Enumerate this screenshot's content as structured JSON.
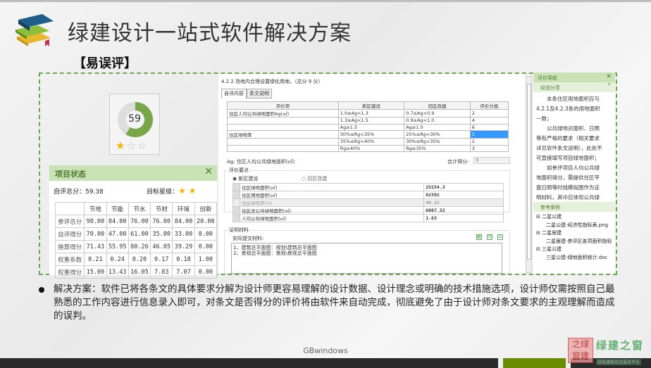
{
  "slide": {
    "title": "绿建设计一站式软件解决方案",
    "subtitle": "【易误评】",
    "footer": "GBwindows"
  },
  "score_card": {
    "score": "59",
    "score_fraction": 0.59,
    "stars_filled": 1,
    "stars_total": 3
  },
  "project_status": {
    "title": "项目状态",
    "close": "✕",
    "total_label": "自评总分：59.38",
    "target_label": "目标星级：",
    "target_stars": 2,
    "columns": [
      "",
      "节地",
      "节能",
      "节水",
      "节材",
      "环境",
      "创新"
    ],
    "rows": [
      [
        "参评总分",
        "98.00",
        "84.00",
        "76.00",
        "76.00",
        "84.00",
        "20.00"
      ],
      [
        "自评得分",
        "70.00",
        "47.00",
        "61.00",
        "35.00",
        "33.00",
        "0.00"
      ],
      [
        "换算得分",
        "71.43",
        "55.95",
        "80.26",
        "46.05",
        "39.29",
        "0.00"
      ],
      [
        "权重系数",
        "0.21",
        "0.24",
        "0.20",
        "0.17",
        "0.18",
        "1.00"
      ],
      [
        "权重得分",
        "15.00",
        "13.43",
        "16.05",
        "7.83",
        "7.07",
        "0.00"
      ]
    ]
  },
  "app": {
    "clause": "4.2.2 场地内合理设置绿化用地。（总分 9 分）",
    "tabs": [
      "自评内容",
      "条文说明"
    ],
    "grid_headers": [
      "评价项",
      "新区建设",
      "旧区改建",
      "评价分值"
    ],
    "grid_rows": [
      [
        "住区人均公共绿地面积Ag(㎡)",
        "1.0≤Ag<1.3",
        "0.7≤Ag<0.9",
        "2"
      ],
      [
        "",
        "1.3≤Ag<1.5",
        "0.9≤Ag<1.0",
        "4"
      ],
      [
        "",
        "Ag≥1.5",
        "Ag≥1.0",
        "6"
      ],
      [
        "住区绿地率",
        "30%≤Rg<35%",
        "25%≤Rg<30%",
        "1"
      ],
      [
        "",
        "35%≤Rg<40%",
        "30%≤Rg<35%",
        "2"
      ],
      [
        "",
        "Rg≥40%",
        "Rg≥35%",
        "3"
      ]
    ],
    "selected_row": 3,
    "ag_note": "Ag: 住区人均公共绿地面积(㎡)",
    "total_label": "合计得分:",
    "total_value": "9",
    "points_legend": "评价要点",
    "radio_new": "新区建设",
    "radio_old": "旧区改建",
    "radio_selected": "新区建设",
    "data_rows": [
      [
        "住区绿地面积(㎡)",
        "25154.3"
      ],
      [
        "住区用地面积(㎡)",
        "62392"
      ],
      [
        "住区绿地率(%)",
        "40.32"
      ],
      [
        "住区总公共绿地面积(㎡)",
        "6087.32"
      ],
      [
        "人均公共绿地面积(㎡)",
        "1.63"
      ]
    ],
    "proof_legend": "证明材料",
    "submit_label": "实际提交材料:",
    "materials": [
      "1、建筑总平面图：规划\\建筑总平面图",
      "2、景观总平面图：景观\\景观总平面图"
    ]
  },
  "nav": {
    "title": "评价导航",
    "close": "✕",
    "share_title": "经验分享",
    "paragraphs": [
      "本条住区用地面积应与4.2.1及4.2.3条的用地面积一致；",
      "公共绿地对面积、日照等有严格的要求（相关要求详见软件条文说明），此处不可直接填写项目绿地面积；",
      "如参评项目人均公共绿地面积得分，需提供住区平面日照等时线模拟图作为证明材料，其中应体现公共绿地的日照和阴影情况，确保"
    ],
    "cases_title": "参考案例",
    "tree": [
      {
        "group": "二星公建",
        "file": "二星公建-经济性指标表.png"
      },
      {
        "group": "二星居建",
        "file": "二星居建-参评区各项面积指标"
      },
      {
        "group": "三星公建",
        "file": "三星公建-绿地面积统计.doc"
      }
    ]
  },
  "bullet": "解决方案：软件已将各条文的具体要求分解为设计师更容易理解的设计数据、设计理念或明确的技术措施选项，设计师仅需按照自己最熟悉的工作内容进行信息录入即可，对条文是否得分的评价将由软件来自动完成，彻底避免了由于设计师对条文要求的主观理解而造成的误判。",
  "watermark": {
    "text": "绿建之窗",
    "url_text": "LVJIAN.NET",
    "tagline": "绿色建筑综合服务平台",
    "seal": "绿建之窗"
  },
  "colors": {
    "accent_green": "#6aa84f",
    "header_green": "#c9e2b3",
    "selection": "#3399ff",
    "star": "#f4b400"
  }
}
